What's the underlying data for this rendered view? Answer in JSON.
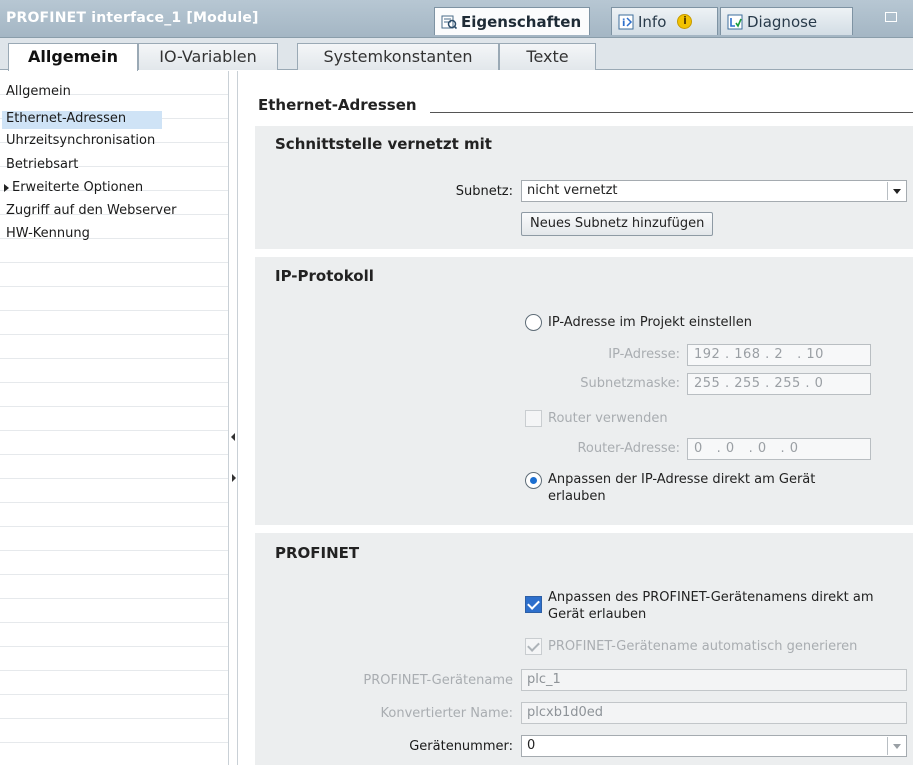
{
  "window": {
    "title": "PROFINET interface_1 [Module]",
    "tabs": [
      {
        "label": "Eigenschaften",
        "icon": "properties-icon",
        "active": true
      },
      {
        "label": "Info",
        "icon": "info-icon",
        "active": false
      },
      {
        "label": "Diagnose",
        "icon": "diagnose-icon",
        "active": false
      }
    ]
  },
  "tabs": [
    {
      "label": "Allgemein",
      "active": true
    },
    {
      "label": "IO-Variablen",
      "active": false
    },
    {
      "label": "Systemkonstanten",
      "active": false
    },
    {
      "label": "Texte",
      "active": false
    }
  ],
  "nav": {
    "items": [
      {
        "label": "Allgemein"
      },
      {
        "label": "Ethernet-Adressen",
        "selected": true
      },
      {
        "label": "Uhrzeitsynchronisation"
      },
      {
        "label": "Betriebsart"
      },
      {
        "label": "Erweiterte Optionen",
        "expandable": true
      },
      {
        "label": "Zugriff auf den Webserver"
      },
      {
        "label": "HW-Kennung"
      }
    ]
  },
  "content": {
    "header": "Ethernet-Adressen",
    "schnittstelle": {
      "title": "Schnittstelle vernetzt mit",
      "subnetz_label": "Subnetz:",
      "subnetz_value": "nicht vernetzt",
      "add_button": "Neues Subnetz hinzufügen"
    },
    "ip": {
      "title": "IP-Protokoll",
      "option_project": "IP-Adresse im Projekt einstellen",
      "ip_label": "IP-Adresse:",
      "ip_value": "192 . 168 . 2   . 10",
      "mask_label": "Subnetzmaske:",
      "mask_value": "255 . 255 . 255 . 0",
      "router_label": "Router verwenden",
      "router_addr_label": "Router-Adresse:",
      "router_addr_value": "0   . 0   . 0   . 0",
      "option_device": "Anpassen der IP-Adresse direkt am Gerät erlauben",
      "selected_option": "device"
    },
    "profinet": {
      "title": "PROFINET",
      "option_allow_name": "Anpassen des PROFINET-Gerätenamens direkt am Gerät erlauben",
      "allow_name_checked": true,
      "option_auto_name": "PROFINET-Gerätename automatisch generieren",
      "auto_name_checked": true,
      "device_name_label": "PROFINET-Gerätename",
      "device_name_value": "plc_1",
      "converted_label": "Konvertierter Name:",
      "converted_value": "plcxb1d0ed",
      "number_label": "Gerätenummer:",
      "number_value": "0"
    }
  },
  "colors": {
    "title_bar": "#a9bac8",
    "selection": "#cfe3f6",
    "panel_bg": "#eceeef",
    "accent": "#1c6fd1"
  }
}
